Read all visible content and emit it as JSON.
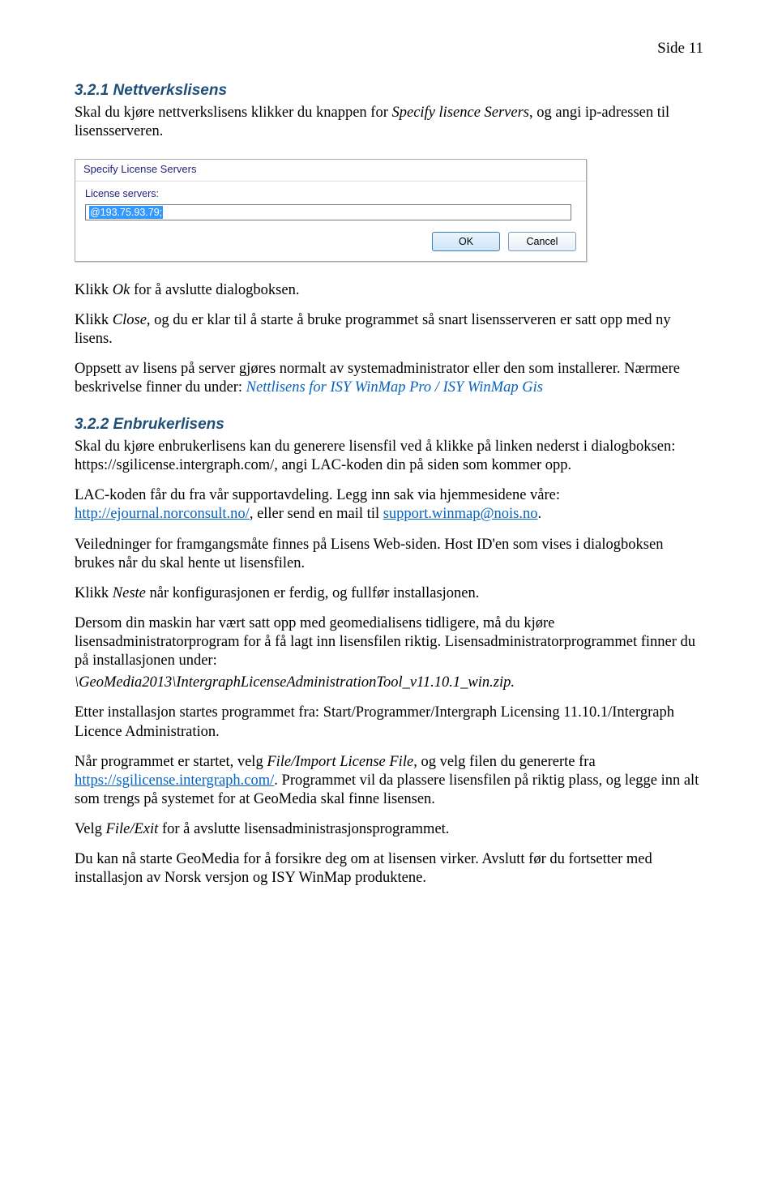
{
  "page_number": "Side 11",
  "sec1": {
    "heading": "3.2.1  Nettverkslisens",
    "p1_a": "Skal du kjøre nettverkslisens klikker du knappen for ",
    "p1_b": "Specify lisence Servers",
    "p1_c": ", og angi ip-adressen til lisensserveren."
  },
  "dialog": {
    "title": "Specify License Servers",
    "label": "License servers:",
    "value": "@193.75.93.79;",
    "ok": "OK",
    "cancel": "Cancel"
  },
  "sec1b": {
    "p2_a": "Klikk ",
    "p2_b": "Ok",
    "p2_c": " for å avslutte dialogboksen.",
    "p3_a": "Klikk ",
    "p3_b": "Close",
    "p3_c": ", og du er klar til å starte å bruke programmet så snart lisensserveren er satt opp med ny lisens.",
    "p4_a": "Oppsett av lisens på server gjøres normalt av systemadministrator eller den som installerer. Nærmere beskrivelse finner du under: ",
    "p4_b": "Nettlisens  for ISY WinMap Pro / ISY WinMap Gis"
  },
  "sec2": {
    "heading": "3.2.2  Enbrukerlisens",
    "p1": "Skal du kjøre enbrukerlisens kan du generere lisensfil ved å klikke på linken nederst i dialogboksen: https://sgilicense.intergraph.com/, angi LAC-koden din på siden som kommer opp.",
    "p2_a": "LAC-koden får du fra vår supportavdeling. Legg inn sak via hjemmesidene våre: ",
    "p2_link1": "http://ejournal.norconsult.no/",
    "p2_b": ", eller send en mail til ",
    "p2_link2": "support.winmap@nois.no",
    "p2_c": ".",
    "p3": "Veiledninger for framgangsmåte finnes på Lisens Web-siden. Host ID'en som vises i dialogboksen brukes når du skal hente ut lisensfilen.",
    "p4_a": "Klikk ",
    "p4_b": "Neste",
    "p4_c": " når konfigurasjonen er ferdig, og fullfør installasjonen.",
    "p5_a": "Dersom din maskin har vært satt opp med geomedialisens tidligere, må du kjøre lisensadministratorprogram for å få lagt inn lisensfilen riktig. Lisensadministratorprogrammet finner du på installasjonen under:",
    "p5_b": "\\GeoMedia2013\\IntergraphLicenseAdministrationTool_v11.10.1_win.zip.",
    "p6": "Etter installasjon startes programmet fra: Start/Programmer/Intergraph Licensing 11.10.1/Intergraph Licence Administration.",
    "p7_a": "Når programmet er startet, velg ",
    "p7_b": "File/Import License File",
    "p7_c": ", og velg filen du genererte fra ",
    "p7_link": "https://sgilicense.intergraph.com/",
    "p7_d": ". Programmet vil da plassere lisensfilen på riktig plass, og legge inn alt som trengs på systemet for at GeoMedia skal finne lisensen.",
    "p8_a": "Velg ",
    "p8_b": "File/Exit",
    "p8_c": " for å avslutte lisensadministrasjonsprogrammet.",
    "p9": "Du kan nå starte GeoMedia for å forsikre deg om at lisensen virker. Avslutt før du fortsetter med installasjon av Norsk versjon og ISY WinMap produktene."
  }
}
